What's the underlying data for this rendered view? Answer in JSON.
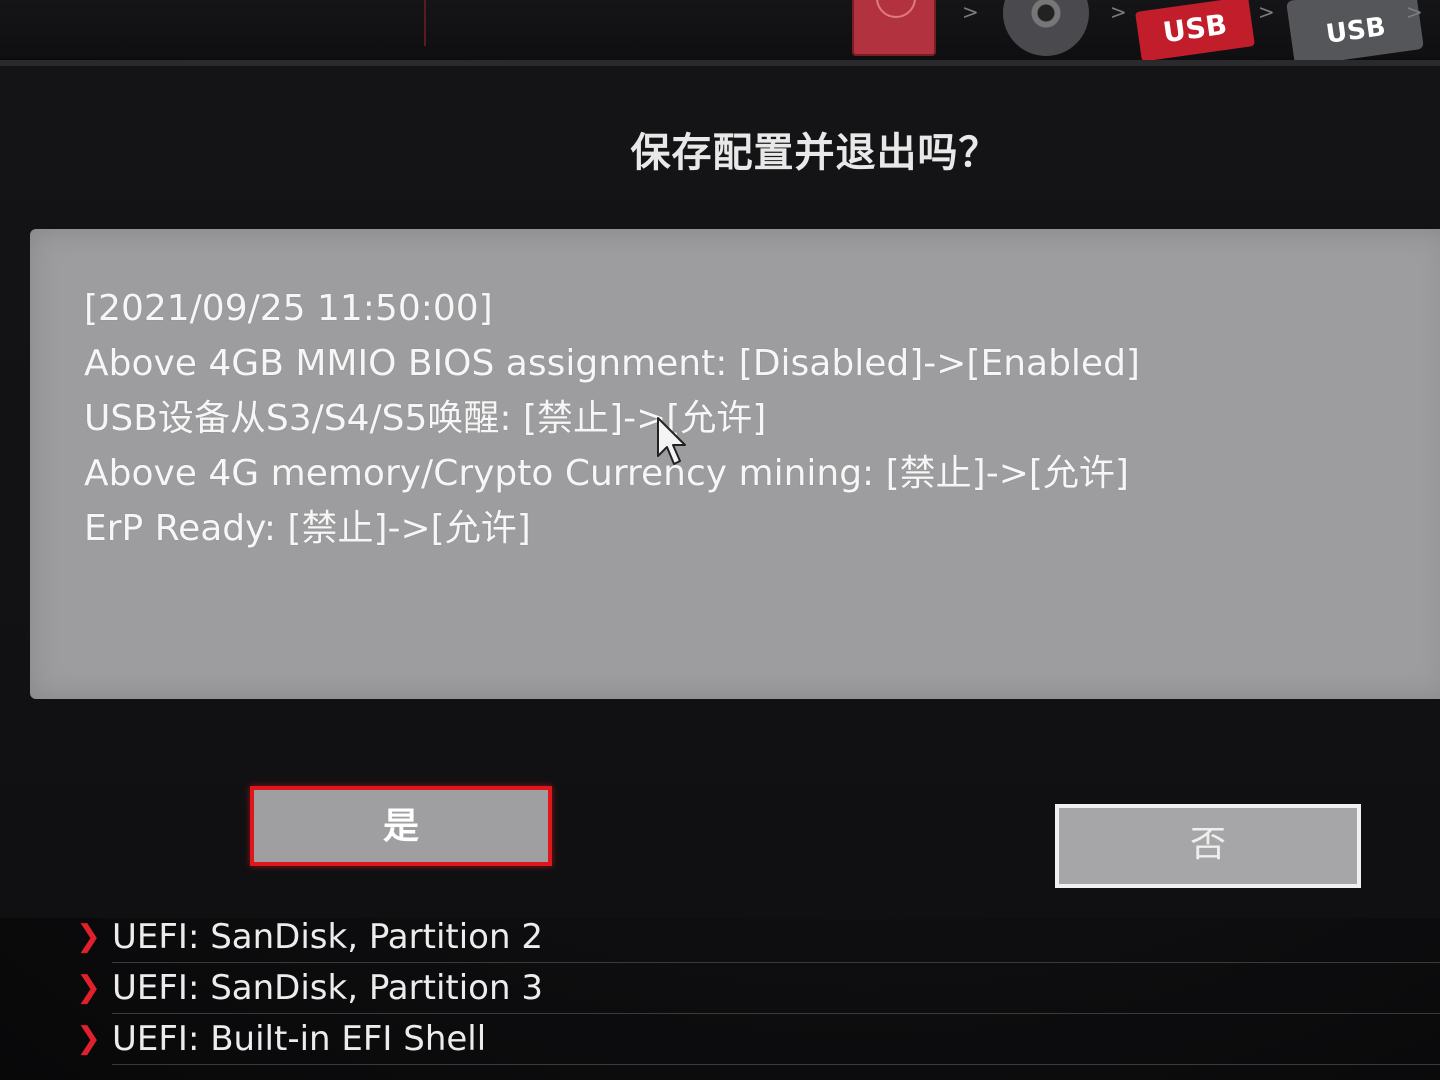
{
  "boot_devices": [
    {
      "name": "hdd",
      "label": ""
    },
    {
      "name": "optical",
      "label": ""
    },
    {
      "name": "usb-1",
      "label": "USB"
    },
    {
      "name": "usb-2",
      "label": "USB"
    }
  ],
  "boot_strip": {
    "chevron": ">"
  },
  "dialog": {
    "title": "保存配置并退出吗？",
    "changes": [
      "[2021/09/25 11:50:00]",
      "Above 4GB MMIO BIOS assignment: [Disabled]->[Enabled]",
      "USB设备从S3/S4/S5唤醒: [禁止]->[允许]",
      "Above 4G memory/Crypto Currency mining: [禁止]->[允许]",
      "ErP Ready: [禁止]->[允许]"
    ],
    "yes_label": "是",
    "no_label": "否"
  },
  "boot_list": [
    {
      "label": "UEFI: SanDisk, Partition 2"
    },
    {
      "label": "UEFI: SanDisk, Partition 3"
    },
    {
      "label": "UEFI: Built-in EFI Shell"
    }
  ],
  "colors": {
    "accent_red": "#e0161d",
    "panel_gray": "#9d9d9f",
    "background": "#101012"
  },
  "icons": {
    "boot_list_bullet": "chevron-right-icon",
    "pointer": "mouse-cursor-icon"
  }
}
